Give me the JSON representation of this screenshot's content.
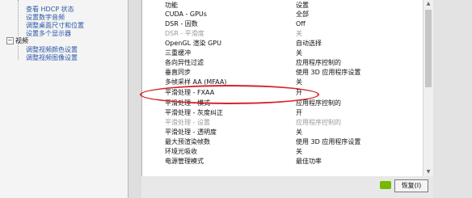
{
  "nav_tree": {
    "partial_items": [
      "",
      "查看 HDCP 状态",
      "设置数字音频",
      "调整桌面尺寸和位置",
      "设置多个显示器"
    ],
    "video_label": "视频",
    "video_items": [
      "调整视频颜色设置",
      "调整视频图像设置"
    ]
  },
  "settings_table": {
    "header": {
      "feature": "功能",
      "setting": "设置"
    },
    "rows": [
      {
        "feature": "CUDA - GPUs",
        "setting": "全部",
        "dim": false
      },
      {
        "feature": "DSR - 因数",
        "setting": "Off",
        "dim": false
      },
      {
        "feature": "DSR - 平滑度",
        "setting": "关",
        "dim": true
      },
      {
        "feature": "OpenGL 渲染 GPU",
        "setting": "自动选择",
        "dim": false
      },
      {
        "feature": "三重缓冲",
        "setting": "关",
        "dim": false
      },
      {
        "feature": "各向异性过滤",
        "setting": "应用程序控制的",
        "dim": false
      },
      {
        "feature": "垂直同步",
        "setting": "使用 3D 应用程序设置",
        "dim": false
      },
      {
        "feature": "多帧采样 AA (MFAA)",
        "setting": "关",
        "dim": false
      },
      {
        "feature": "平滑处理 - FXAA",
        "setting": "开",
        "dim": false
      },
      {
        "feature": "平滑处理 - 模式",
        "setting": "应用程序控制的",
        "dim": false
      },
      {
        "feature": "平滑处理 - 灰度纠正",
        "setting": "开",
        "dim": false
      },
      {
        "feature": "平滑处理 - 设置",
        "setting": "应用程序控制的",
        "dim": true
      },
      {
        "feature": "平滑处理 - 透明度",
        "setting": "关",
        "dim": false
      },
      {
        "feature": "最大预渲染帧数",
        "setting": "使用 3D 应用程序设置",
        "dim": false
      },
      {
        "feature": "环境光吸收",
        "setting": "关",
        "dim": false
      },
      {
        "feature": "电源管理模式",
        "setting": "最佳功率",
        "dim": false
      }
    ]
  },
  "restore_button": {
    "label": "恢复(I)"
  },
  "colors": {
    "annotation": "#d8242a",
    "nvidia_green": "#76b900",
    "link": "#2a57a8"
  },
  "icons": {
    "logo": "nvidia-logo",
    "expander": "collapse-minus"
  }
}
